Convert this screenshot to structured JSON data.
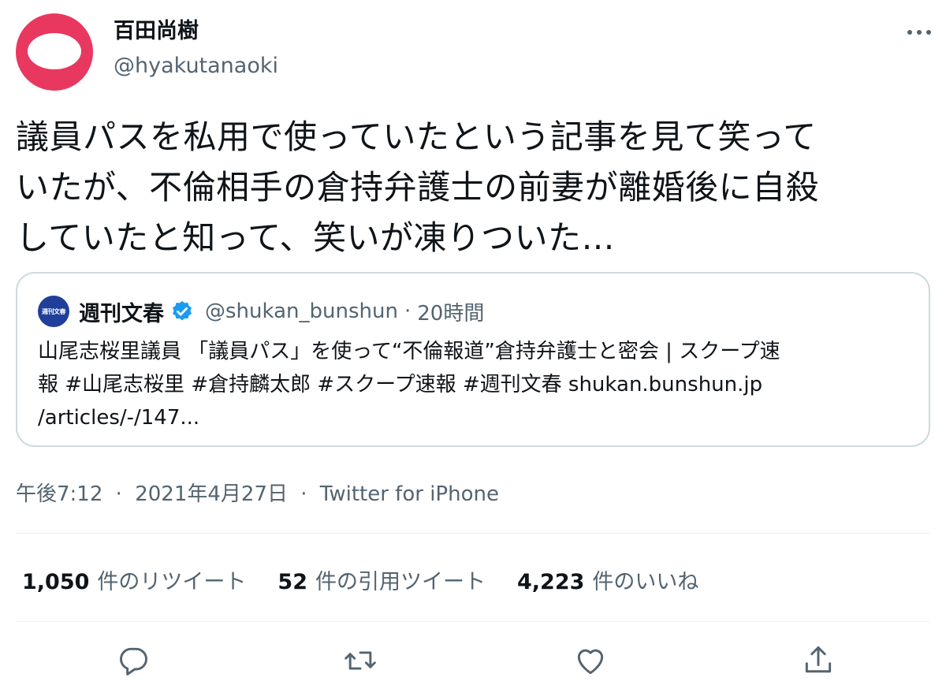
{
  "author": {
    "display_name": "百田尚樹",
    "handle": "@hyakutanaoki",
    "avatar_icon": "avatar-icon",
    "avatar_color": "#e8385f"
  },
  "more_icon": "more-icon",
  "tweet": {
    "lines": [
      "議員パスを私用で使っていたという記事を見て笑って",
      "いたが、不倫相手の倉持弁護士の前妻が離婚後に自殺",
      "していたと知って、笑いが凍りついた…"
    ]
  },
  "quote": {
    "avatar_text": "週刊文春",
    "name": "週刊文春",
    "verified_icon": "verified-icon",
    "handle": "@shukan_bunshun",
    "dot": "·",
    "time": "20時間",
    "lines": [
      "山尾志桜里議員 「議員パス」を使って“不倫報道”倉持弁護士と密会 | スクープ速",
      "報 #山尾志桜里 #倉持麟太郎 #スクープ速報 #週刊文春 shukan.bunshun.jp",
      "/articles/-/147..."
    ]
  },
  "meta": {
    "time": "午後7:12",
    "date": "2021年4月27日",
    "source": "Twitter for iPhone",
    "sep": "·"
  },
  "stats": {
    "retweets": {
      "count": "1,050",
      "label": "件のリツイート"
    },
    "quotes": {
      "count": "52",
      "label": "件の引用ツイート"
    },
    "likes": {
      "count": "4,223",
      "label": "件のいいね"
    }
  },
  "actions": [
    "reply-icon",
    "retweet-icon",
    "like-icon",
    "share-icon"
  ],
  "colors": {
    "text": "#0f1419",
    "secondary": "#536471",
    "border": "#cfd9de",
    "verified": "#1d9bf0"
  }
}
